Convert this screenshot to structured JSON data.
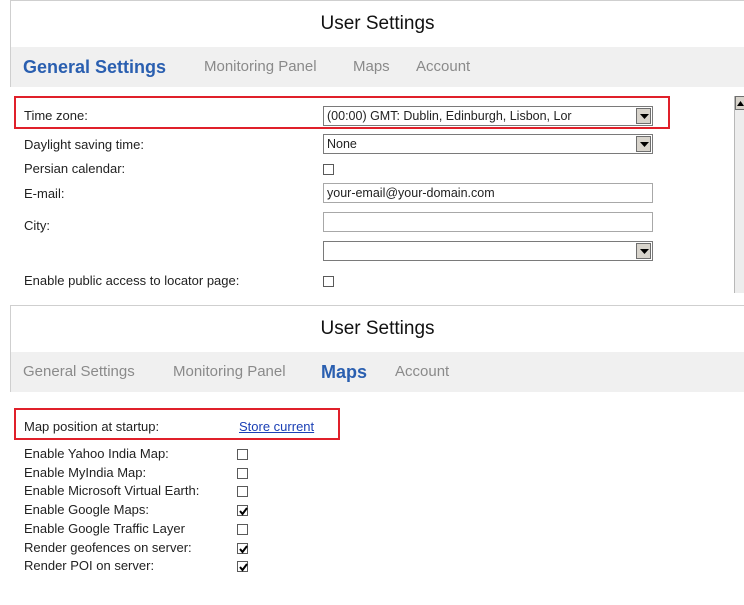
{
  "panel1": {
    "title": "User Settings",
    "tabs": [
      "General Settings",
      "Monitoring Panel",
      "Maps",
      "Account"
    ],
    "timezone_label": "Time zone:",
    "timezone_value": "(00:00) GMT: Dublin, Edinburgh, Lisbon, Lor",
    "dst_label": "Daylight saving time:",
    "dst_value": "None",
    "persian_label": "Persian calendar:",
    "email_label": "E-mail:",
    "email_value": "your-email@your-domain.com",
    "city_label": "City:",
    "city_value": "",
    "city_select_value": "",
    "public_label": "Enable public access to locator page:"
  },
  "panel2": {
    "title": "User Settings",
    "tabs": [
      "General Settings",
      "Monitoring Panel",
      "Maps",
      "Account"
    ],
    "map_position_label": "Map position at startup:",
    "store_current_link": "Store current",
    "options": [
      {
        "label": "Enable Yahoo India Map:",
        "checked": false
      },
      {
        "label": "Enable MyIndia Map:",
        "checked": false
      },
      {
        "label": "Enable Microsoft Virtual Earth:",
        "checked": false
      },
      {
        "label": "Enable Google Maps:",
        "checked": true
      },
      {
        "label": "Enable Google Traffic Layer",
        "checked": false
      },
      {
        "label": "Render geofences on server:",
        "checked": true
      },
      {
        "label": "Render POI on server:",
        "checked": true
      }
    ]
  },
  "colors": {
    "active_tab": "#2a5fb0",
    "inactive_tab": "#8a8a8a",
    "highlight": "#e0202a",
    "link": "#1a3fb5",
    "tab_bar_bg": "#f0f0f0"
  },
  "icons": [
    "dropdown-arrow-icon",
    "checkmark-icon",
    "scroll-up-arrow-icon"
  ]
}
